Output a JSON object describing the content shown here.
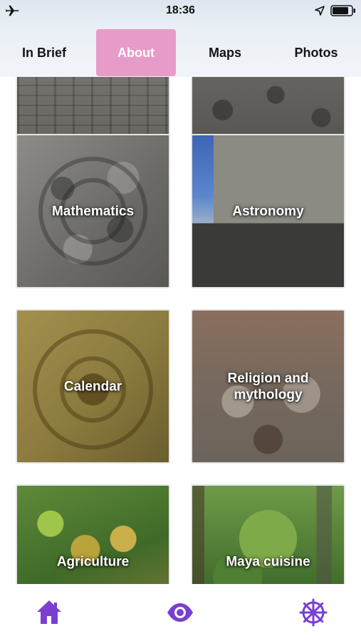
{
  "status_bar": {
    "time": "18:36",
    "left_icon": "airplane-icon",
    "right_icons": [
      "location-arrow-icon",
      "battery-icon"
    ]
  },
  "tabs": [
    {
      "label": "In Brief",
      "active": false
    },
    {
      "label": "About",
      "active": true
    },
    {
      "label": "Maps",
      "active": false
    },
    {
      "label": "Photos",
      "active": false
    }
  ],
  "colors": {
    "accent": "#e79bc8",
    "icon_purple": "#7a3fd0"
  },
  "tiles": [
    {
      "label": "",
      "image": "stone-wall"
    },
    {
      "label": "",
      "image": "stone-carvings"
    },
    {
      "label": "Mathematics",
      "image": "carved-stone-disc"
    },
    {
      "label": "Astronomy",
      "image": "temple-ruins"
    },
    {
      "label": "Calendar",
      "image": "aztec-calendar-stone"
    },
    {
      "label": "Religion and mythology",
      "image": "relief-carving"
    },
    {
      "label": "Agriculture",
      "image": "coconut-palm"
    },
    {
      "label": "Maya cuisine",
      "image": "jungle-forest"
    }
  ],
  "bottom_nav": [
    {
      "icon": "home-icon"
    },
    {
      "icon": "eye-icon"
    },
    {
      "icon": "settings-wheel-icon"
    }
  ]
}
